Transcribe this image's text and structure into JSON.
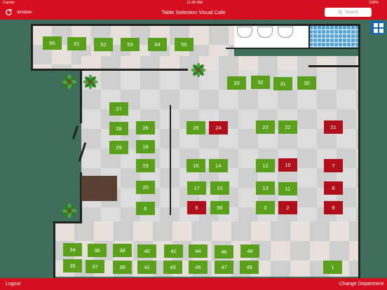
{
  "status_bar": {
    "carrier": "Carrier",
    "time": "11:39 AM",
    "battery": "100%"
  },
  "header": {
    "org_name": "sindata",
    "title": "Table Selection Visual Cafe",
    "search_placeholder": "Search"
  },
  "footer": {
    "logout_label": "Logout",
    "change_department_label": "Change Department"
  },
  "colors": {
    "accent": "#d50f1f",
    "available": "#5aa01a",
    "occupied": "#b00e1a",
    "view_toggle": "#1565c0"
  },
  "tables": [
    {
      "label": "50",
      "status": "available"
    },
    {
      "label": "51",
      "status": "available"
    },
    {
      "label": "52",
      "status": "available"
    },
    {
      "label": "53",
      "status": "available"
    },
    {
      "label": "54",
      "status": "available"
    },
    {
      "label": "55",
      "status": "available"
    },
    {
      "label": "33",
      "status": "available"
    },
    {
      "label": "32",
      "status": "available"
    },
    {
      "label": "31",
      "status": "available"
    },
    {
      "label": "30",
      "status": "available"
    },
    {
      "label": "27",
      "status": "available"
    },
    {
      "label": "28",
      "status": "available"
    },
    {
      "label": "29",
      "status": "available"
    },
    {
      "label": "26",
      "status": "available"
    },
    {
      "label": "18",
      "status": "available"
    },
    {
      "label": "19",
      "status": "available"
    },
    {
      "label": "20",
      "status": "available"
    },
    {
      "label": "6",
      "status": "available"
    },
    {
      "label": "25",
      "status": "available"
    },
    {
      "label": "24",
      "status": "occupied"
    },
    {
      "label": "16",
      "status": "available"
    },
    {
      "label": "14",
      "status": "available"
    },
    {
      "label": "17",
      "status": "available"
    },
    {
      "label": "15",
      "status": "available"
    },
    {
      "label": "5",
      "status": "occupied"
    },
    {
      "label": "56",
      "status": "available"
    },
    {
      "label": "23",
      "status": "available"
    },
    {
      "label": "22",
      "status": "available"
    },
    {
      "label": "12",
      "status": "available"
    },
    {
      "label": "10",
      "status": "occupied"
    },
    {
      "label": "13",
      "status": "available"
    },
    {
      "label": "11",
      "status": "available"
    },
    {
      "label": "3",
      "status": "available"
    },
    {
      "label": "2",
      "status": "occupied"
    },
    {
      "label": "21",
      "status": "occupied"
    },
    {
      "label": "7",
      "status": "occupied"
    },
    {
      "label": "8",
      "status": "occupied"
    },
    {
      "label": "9",
      "status": "occupied"
    },
    {
      "label": "34",
      "status": "available"
    },
    {
      "label": "36",
      "status": "available"
    },
    {
      "label": "38",
      "status": "available"
    },
    {
      "label": "40",
      "status": "available"
    },
    {
      "label": "42",
      "status": "available"
    },
    {
      "label": "44",
      "status": "available"
    },
    {
      "label": "46",
      "status": "available"
    },
    {
      "label": "48",
      "status": "available"
    },
    {
      "label": "35",
      "status": "available"
    },
    {
      "label": "37",
      "status": "available"
    },
    {
      "label": "39",
      "status": "available"
    },
    {
      "label": "41",
      "status": "available"
    },
    {
      "label": "43",
      "status": "available"
    },
    {
      "label": "45",
      "status": "available"
    },
    {
      "label": "47",
      "status": "available"
    },
    {
      "label": "49",
      "status": "available"
    },
    {
      "label": "1",
      "status": "available"
    }
  ]
}
